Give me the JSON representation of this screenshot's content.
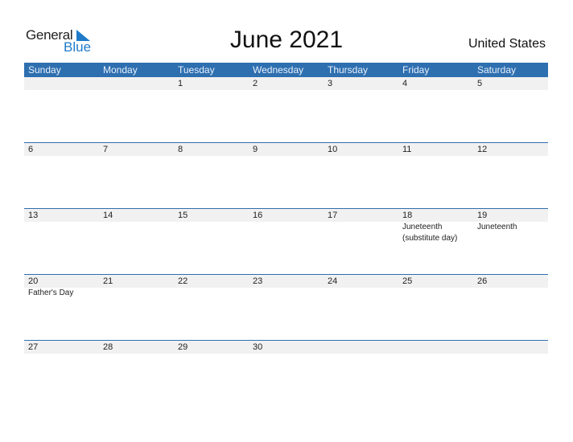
{
  "logo": {
    "general": "General",
    "blue": "Blue",
    "icon": "triangle-flag-icon"
  },
  "title": "June 2021",
  "country": "United States",
  "weekdays": [
    "Sunday",
    "Monday",
    "Tuesday",
    "Wednesday",
    "Thursday",
    "Friday",
    "Saturday"
  ],
  "weeks": [
    {
      "days": [
        "",
        "",
        "1",
        "2",
        "3",
        "4",
        "5"
      ],
      "events": [
        "",
        "",
        "",
        "",
        "",
        "",
        ""
      ]
    },
    {
      "days": [
        "6",
        "7",
        "8",
        "9",
        "10",
        "11",
        "12"
      ],
      "events": [
        "",
        "",
        "",
        "",
        "",
        "",
        ""
      ]
    },
    {
      "days": [
        "13",
        "14",
        "15",
        "16",
        "17",
        "18",
        "19"
      ],
      "events": [
        "",
        "",
        "",
        "",
        "",
        "Juneteenth (substitute day)",
        "Juneteenth"
      ]
    },
    {
      "days": [
        "20",
        "21",
        "22",
        "23",
        "24",
        "25",
        "26"
      ],
      "events": [
        "Father's Day",
        "",
        "",
        "",
        "",
        "",
        ""
      ]
    },
    {
      "days": [
        "27",
        "28",
        "29",
        "30",
        "",
        "",
        ""
      ],
      "events": [
        "",
        "",
        "",
        "",
        "",
        "",
        ""
      ]
    }
  ],
  "colors": {
    "header": "#2e6fb0",
    "brand_blue": "#1f7bc9",
    "date_band": "#f1f1f1"
  }
}
